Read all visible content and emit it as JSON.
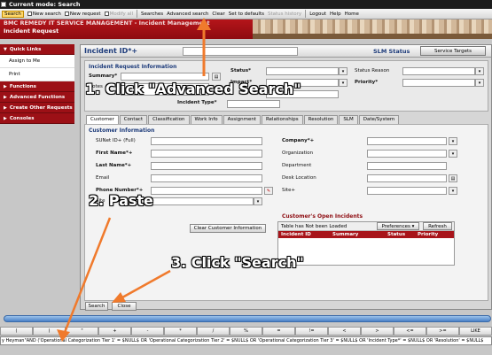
{
  "mode_bar": {
    "label": "Current mode: Search"
  },
  "toolbar": {
    "items": [
      {
        "label": "Search",
        "state": "active"
      },
      {
        "label": "New search",
        "state": "normal",
        "icon": "magnifier-icon"
      },
      {
        "label": "New request",
        "state": "normal",
        "icon": "document-icon"
      },
      {
        "label": "Modify all",
        "state": "disabled",
        "icon": "edit-icon"
      },
      {
        "label": "Searches",
        "state": "normal"
      },
      {
        "label": "Advanced search",
        "state": "normal"
      },
      {
        "label": "Clear",
        "state": "normal"
      },
      {
        "label": "Set to defaults",
        "state": "normal"
      },
      {
        "label": "Status history",
        "state": "disabled"
      },
      {
        "label": "Logout",
        "state": "normal"
      },
      {
        "label": "Help",
        "state": "normal"
      },
      {
        "label": "Home",
        "state": "normal"
      }
    ]
  },
  "banner": {
    "line1": "BMC REMEDY IT SERVICE MANAGEMENT - Incident Management",
    "line2": "Incident Request"
  },
  "left_nav": {
    "sections": [
      {
        "label": "Quick Links",
        "expanded": true,
        "items": [
          "Assign to Me",
          "Print"
        ]
      },
      {
        "label": "Functions",
        "expanded": false,
        "items": []
      },
      {
        "label": "Advanced Functions",
        "expanded": false,
        "items": []
      },
      {
        "label": "Create Other Requests",
        "expanded": false,
        "items": []
      },
      {
        "label": "Consoles",
        "expanded": false,
        "items": []
      }
    ]
  },
  "header": {
    "title": "Incident ID*+",
    "slm_status": "SLM Status",
    "service_targets": "Service Targets"
  },
  "info": {
    "heading": "Incident Request Information",
    "summary": "Summary*",
    "notes": "Notes",
    "incident_type": "Incident Type*",
    "status": "Status*",
    "impact": "Impact*",
    "status_reason": "Status Reason",
    "priority": "Priority*"
  },
  "tabs": [
    "Customer",
    "Contact",
    "Classification",
    "Work Info",
    "Assignment",
    "Relationships",
    "Resolution",
    "SLM",
    "Date/System"
  ],
  "customer": {
    "heading": "Customer Information",
    "left_fields": [
      "SUNet ID+ (Full)",
      "First Name*+",
      "Last Name*+",
      "Email",
      "Phone Number*+",
      "Site"
    ],
    "right_fields": [
      "Company*+",
      "Organization",
      "Department",
      "Desk Location",
      "Site+"
    ],
    "clear_button": "Clear Customer Information"
  },
  "open_incidents": {
    "heading": "Customer's Open Incidents",
    "status": "Table has Not been Loaded",
    "preferences": "Preferences ▾",
    "refresh": "Refresh",
    "columns": [
      "Incident ID",
      "Summary",
      "Status",
      "Priority"
    ]
  },
  "bottom_buttons": {
    "search": "Search",
    "close": "Close"
  },
  "operators": [
    "(",
    ")",
    "\"",
    "+",
    "-",
    "*",
    "/",
    "%",
    "=",
    "!=",
    "<",
    ">",
    "<=",
    ">=",
    "LIKE"
  ],
  "qualification": "y Heyman\"AND ('Operational Categorization Tier 1' = $NULL$ OR 'Operational Categorization Tier 2' = $NULL$ OR 'Operational Categorization Tier 3' = $NULL$ OR 'Incident Type*' = $NULL$ OR 'Resolution' = $NULL$",
  "annotations": {
    "step1": "1. Click \"Advanced Search\"",
    "step2": "2. Paste",
    "step3": "3. Click \"Search\"",
    "arrow_color": "#f07a2c"
  }
}
